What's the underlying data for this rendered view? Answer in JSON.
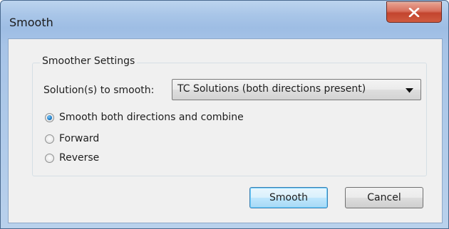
{
  "window": {
    "title": "Smooth",
    "close_glyph": "X"
  },
  "group": {
    "legend": "Smoother Settings",
    "solutions_label": "Solution(s) to smooth:",
    "solutions_selected": "TC Solutions (both directions present)"
  },
  "radios": [
    {
      "label": "Smooth both directions and combine",
      "checked": true
    },
    {
      "label": "Forward",
      "checked": false
    },
    {
      "label": "Reverse",
      "checked": false
    }
  ],
  "buttons": {
    "smooth": "Smooth",
    "cancel": "Cancel"
  },
  "icons": {
    "close": "close-icon",
    "dropdown": "chevron-down-icon"
  },
  "colors": {
    "titlebar": "#a9c6e8",
    "close_button": "#c3442e",
    "client": "#f0f0f0",
    "default_button_border": "#3c7fb1"
  }
}
